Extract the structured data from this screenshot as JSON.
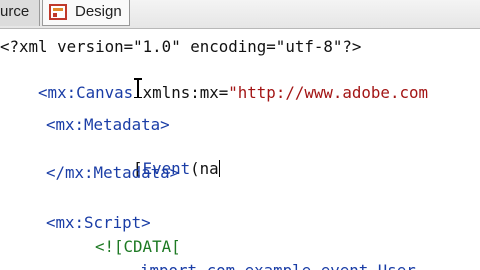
{
  "tabs": {
    "source_label": "urce",
    "design_label": "Design"
  },
  "code": {
    "l1": "<?xml version=\"1.0\" encoding=\"utf-8\"?>",
    "l2_tag": "<mx:Canvas",
    "l2_attr": " xmlns:mx=",
    "l2_val": "\"http://www.adobe.com",
    "l4": "<mx:Metadata>",
    "l5_bracket": "[",
    "l5_event": "Event",
    "l5_rest": "(na",
    "l6": "</mx:Metadata>",
    "l8": "<mx:Script>",
    "l9": "<![CDATA[",
    "l10": "import com.example.event.User"
  },
  "colors": {
    "tag": "#1a3da6",
    "string": "#a31515",
    "cdata": "#1e7a24"
  }
}
